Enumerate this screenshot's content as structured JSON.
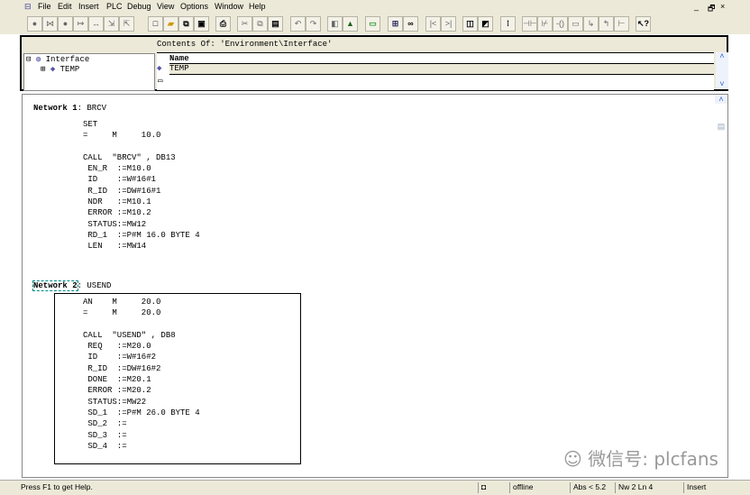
{
  "menu": {
    "items": [
      "File",
      "Edit",
      "Insert",
      "PLC",
      "Debug",
      "View",
      "Options",
      "Window",
      "Help"
    ]
  },
  "window_controls": {
    "minimize": "_",
    "restore": "🗗",
    "close": "×"
  },
  "interface": {
    "contents_of": "Contents Of: 'Environment\\Interface'",
    "tree": [
      {
        "label": "Interface",
        "expander": "⊟"
      },
      {
        "label": "TEMP",
        "expander": "⊞"
      }
    ],
    "column_header": "Name",
    "rows": [
      "TEMP"
    ]
  },
  "networks": [
    {
      "title": "Network 1",
      "name": ": BRCV",
      "lines": [
        "SET",
        "=     M     10.0",
        "",
        "CALL  \"BRCV\" , DB13",
        " EN_R  :=M10.0",
        " ID    :=W#16#1",
        " R_ID  :=DW#16#1",
        " NDR   :=M10.1",
        " ERROR :=M10.2",
        " STATUS:=MW12",
        " RD_1  :=P#M 16.0 BYTE 4",
        " LEN   :=MW14"
      ]
    },
    {
      "title": "Network 2",
      "name": ": USEND",
      "lines": [
        "AN    M     20.0",
        "=     M     20.0",
        "",
        "CALL  \"USEND\" , DB8",
        " REQ   :=M20.0",
        " ID    :=W#16#2",
        " R_ID  :=DW#16#2",
        " DONE  :=M20.1",
        " ERROR :=M20.2",
        " STATUS:=MW22",
        " SD_1  :=P#M 26.0 BYTE 4",
        " SD_2  :=",
        " SD_3  :=",
        " SD_4  :="
      ]
    }
  ],
  "watermark": "微信号: plcfans",
  "status": {
    "help": "Press F1 to get Help.",
    "mode": "offline",
    "abs": "Abs < 5.2",
    "position": "Nw 2 Ln 4",
    "insert": "Insert"
  }
}
